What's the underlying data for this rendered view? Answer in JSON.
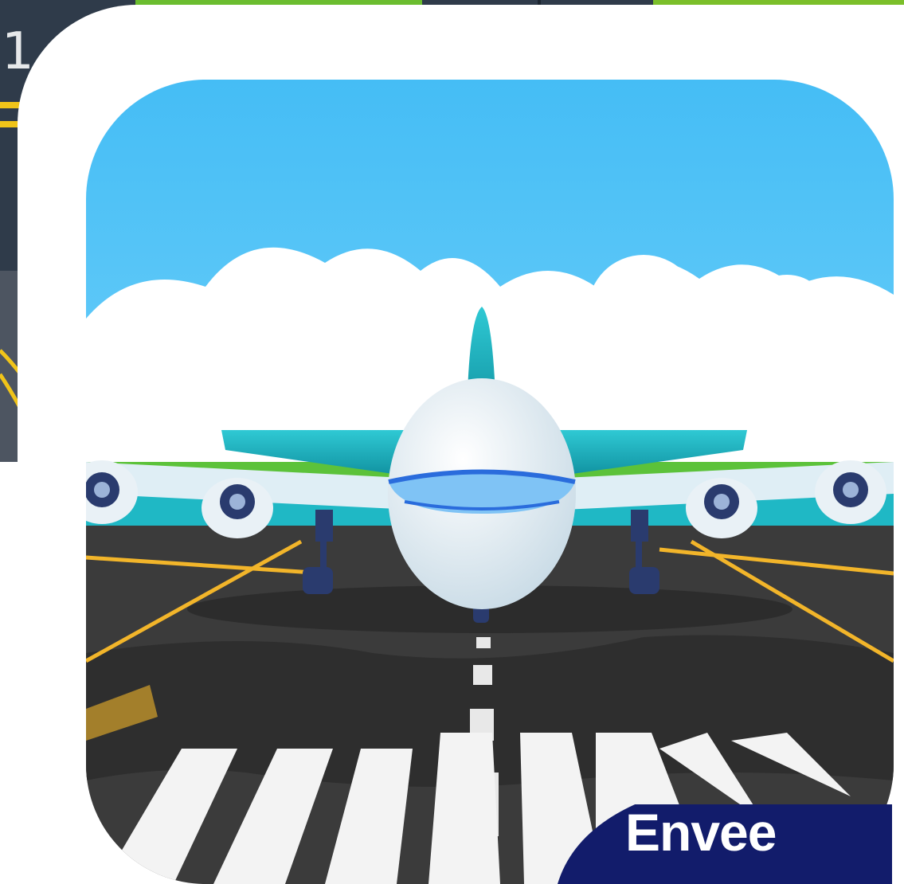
{
  "background": {
    "level_number": "1"
  },
  "app_icon": {
    "brand_label": "Envee",
    "colors": {
      "sky": "#4fc3f7",
      "cloud": "#ffffff",
      "grass": "#5cc23a",
      "runway": "#3b3b3b",
      "runway_line": "#f2b52a",
      "plane_body": "#e9f1f6",
      "plane_wing": "#1fb8c5",
      "cockpit": "#2a6cdc",
      "brand_badge": "#121c6b",
      "frame_green": "#7bbf2a"
    }
  }
}
